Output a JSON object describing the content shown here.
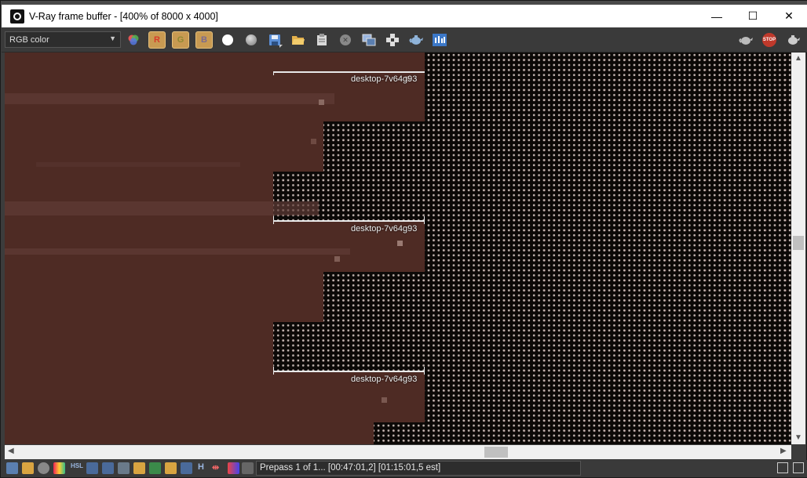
{
  "window": {
    "title": "V-Ray frame buffer - [400% of 8000 x 4000]",
    "controls": {
      "minimize": "—",
      "maximize": "☐",
      "close": "✕"
    }
  },
  "toolbar": {
    "channel": "RGB color",
    "buttons": [
      {
        "name": "color-balls-icon"
      },
      {
        "name": "red-channel-button",
        "label": "R"
      },
      {
        "name": "green-channel-button",
        "label": "G"
      },
      {
        "name": "blue-channel-button",
        "label": "B"
      },
      {
        "name": "white-circle-icon"
      },
      {
        "name": "mono-circle-icon"
      },
      {
        "name": "save-icon"
      },
      {
        "name": "open-folder-icon"
      },
      {
        "name": "clipboard-icon"
      },
      {
        "name": "clear-icon"
      },
      {
        "name": "duplicate-icon"
      },
      {
        "name": "region-icon"
      },
      {
        "name": "teapot-icon"
      },
      {
        "name": "histogram-icon"
      },
      {
        "name": "render-teapot-icon"
      },
      {
        "name": "stop-icon",
        "label": "STOP"
      },
      {
        "name": "render-last-icon"
      }
    ]
  },
  "viewport": {
    "bucket_labels": [
      "desktop-7v64g93",
      "desktop-7v64g93",
      "desktop-7v64g93"
    ]
  },
  "statusbar": {
    "status": "Prepass 1 of 1... [00:47:01,2] [01:15:01,5 est]",
    "glyphs": {
      "h": "H"
    }
  },
  "colors": {
    "render_brown": "#4e2b24",
    "background_dark": "#0c0907",
    "toolbar": "#3a3a3a"
  }
}
